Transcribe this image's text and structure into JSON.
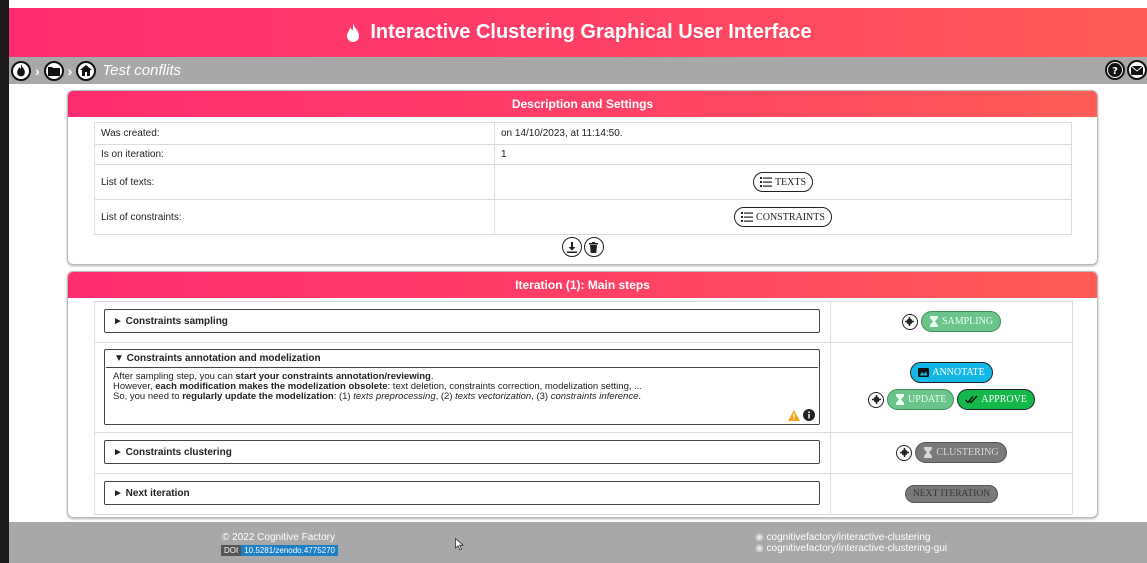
{
  "app": {
    "title": "Interactive Clustering Graphical User Interface"
  },
  "breadcrumb": {
    "project_name": "Test conflits"
  },
  "description_panel": {
    "title": "Description and Settings",
    "rows": [
      {
        "label": "Was created:",
        "value": "on 14/10/2023, at 11:14:50."
      },
      {
        "label": "Is on iteration:",
        "value": "1"
      },
      {
        "label": "List of texts:",
        "button": "TEXTS"
      },
      {
        "label": "List of constraints:",
        "button": "CONSTRAINTS"
      }
    ]
  },
  "iteration_panel": {
    "title": "Iteration (1): Main steps",
    "steps": {
      "sampling": {
        "title": "► Constraints sampling",
        "button": "SAMPLING"
      },
      "annotation": {
        "title": "▼ Constraints annotation and modelization",
        "line1_pre": "After sampling step, you can ",
        "line1_bold": "start your constraints annotation/reviewing",
        "line1_post": ".",
        "line2_pre": "However, ",
        "line2_bold": "each modification makes the modelization obsolete",
        "line2_post": ": text deletion, constraints correction, modelization setting, ...",
        "line3_pre": "So, you need to ",
        "line3_bold": "regularly update the modelization",
        "line3_mid1": ": (1) ",
        "line3_it1": "texts preprocessing",
        "line3_mid2": ", (2) ",
        "line3_it2": "texts vectorization",
        "line3_mid3": ", (3) ",
        "line3_it3": "constraints inference",
        "line3_post": ".",
        "annotate_button": "ANNOTATE",
        "update_button": "UPDATE",
        "approve_button": "APPROVE"
      },
      "clustering": {
        "title": "► Constraints clustering",
        "button": "CLUSTERING"
      },
      "next": {
        "title": "► Next iteration",
        "button": "NEXT ITERATION"
      }
    }
  },
  "footer": {
    "copyright": "© 2022 Cognitive Factory",
    "doi_label": "DOI",
    "doi_value": "10.5281/zenodo.4775270",
    "repo1": "cognitivefactory/interactive-clustering",
    "repo2": "cognitivefactory/interactive-clustering-gui"
  },
  "colors": {
    "header_gradient_start": "#ff2d6f",
    "header_gradient_end": "#ff5c57",
    "navbar": "#a8a8a8",
    "sampling_button": "#6bc48a",
    "approve_button": "#14b84a",
    "annotate_button": "#11b8e6",
    "disabled_button": "#7a7a7a"
  },
  "icons": [
    "fire-icon",
    "folder-icon",
    "home-icon",
    "help-icon",
    "mail-icon",
    "list-icon",
    "download-icon",
    "trash-icon",
    "gear-icon",
    "hourglass-icon",
    "image-icon",
    "check-double-icon",
    "warning-icon",
    "info-icon"
  ]
}
